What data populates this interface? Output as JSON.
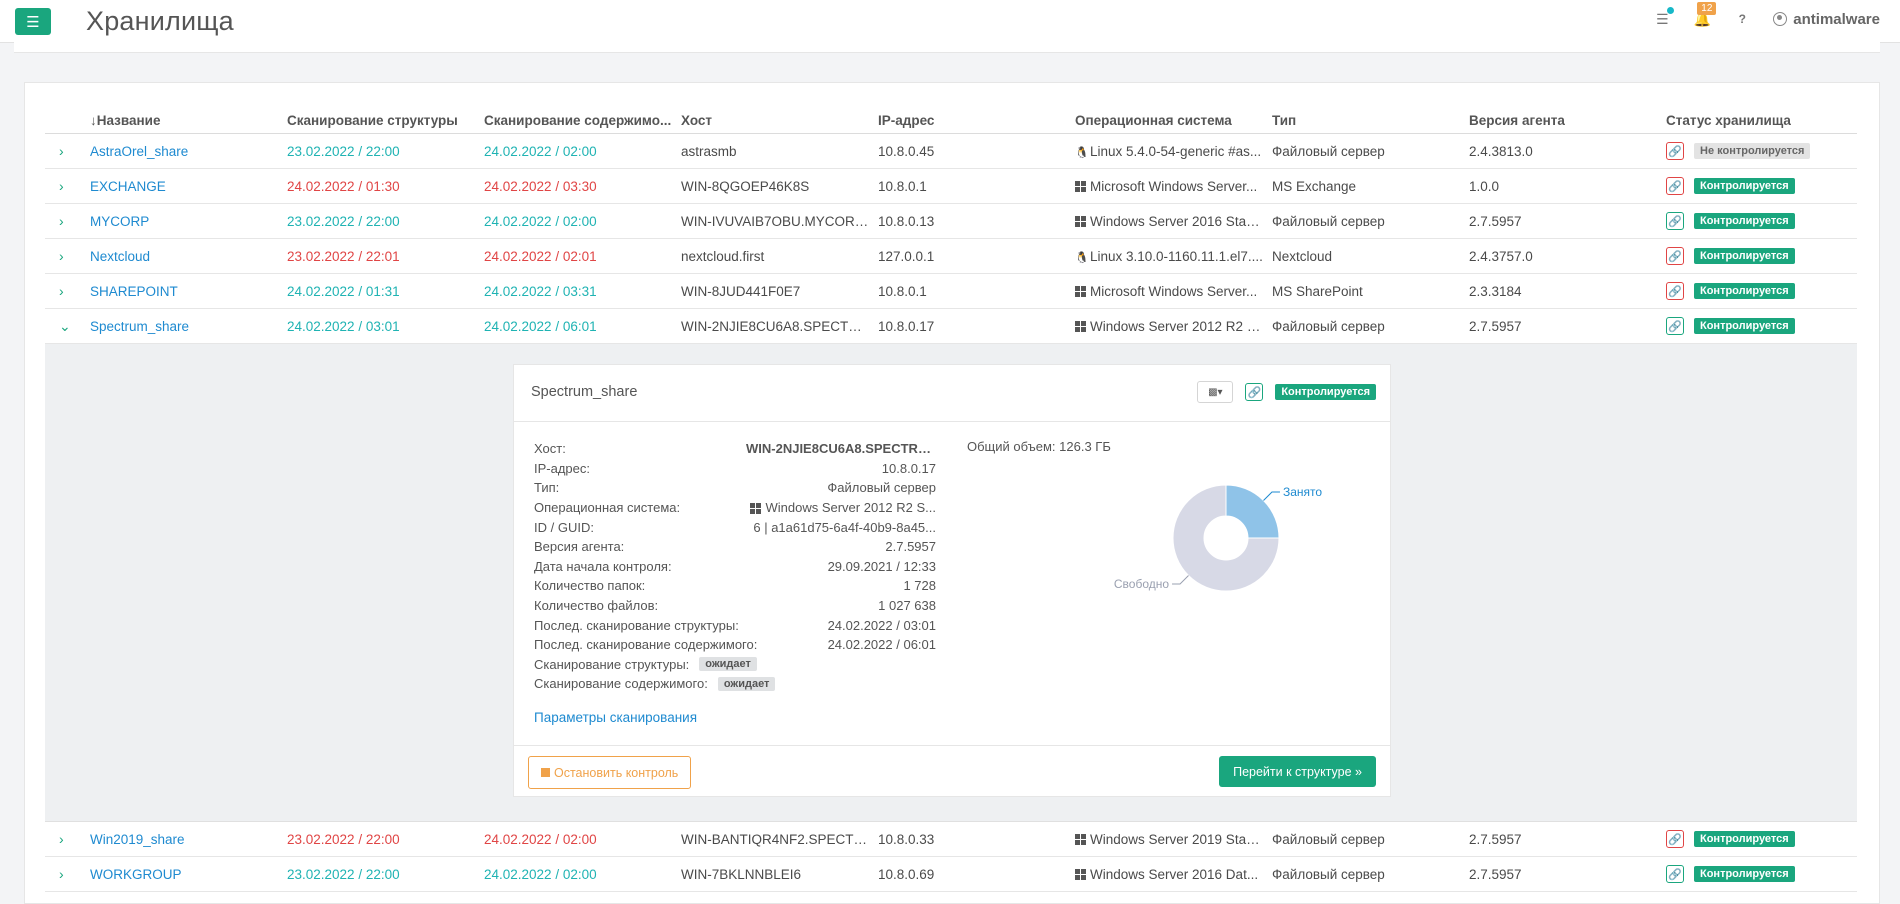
{
  "header": {
    "title": "Хранилища",
    "notifications_count": "12",
    "user": "antimalware"
  },
  "table": {
    "columns": [
      "Название",
      "Сканирование структуры",
      "Сканирование содержимо...",
      "Хост",
      "IP-адрес",
      "Операционная система",
      "Тип",
      "Версия агента",
      "Статус хранилища"
    ],
    "rows": [
      {
        "name": "AstraOrel_share",
        "struct": "23.02.2022 / 22:00",
        "struct_color": "teal",
        "content": "24.02.2022 / 02:00",
        "content_color": "teal",
        "host": "astrasmb",
        "ip": "10.8.0.45",
        "os_icon": "linux-icon",
        "os": "Linux 5.4.0-54-generic #as...",
        "type": "Файловый сервер",
        "agent": "2.4.3813.0",
        "link_color": "red",
        "status": "Не контролируется",
        "status_style": "grey"
      },
      {
        "name": "EXCHANGE",
        "struct": "24.02.2022 / 01:30",
        "struct_color": "red",
        "content": "24.02.2022 / 03:30",
        "content_color": "red",
        "host": "WIN-8QGOEP46K8S",
        "ip": "10.8.0.1",
        "os_icon": "windows-icon",
        "os": "Microsoft Windows Server...",
        "type": "MS Exchange",
        "agent": "1.0.0",
        "link_color": "red",
        "status": "Контролируется",
        "status_style": "green"
      },
      {
        "name": "MYCORP",
        "struct": "23.02.2022 / 22:00",
        "struct_color": "teal",
        "content": "24.02.2022 / 02:00",
        "content_color": "teal",
        "host": "WIN-IVUVAIB7OBU.MYCORP....",
        "ip": "10.8.0.13",
        "os_icon": "windows-icon",
        "os": "Windows Server 2016 Stan...",
        "type": "Файловый сервер",
        "agent": "2.7.5957",
        "link_color": "green",
        "status": "Контролируется",
        "status_style": "green"
      },
      {
        "name": "Nextcloud",
        "struct": "23.02.2022 / 22:01",
        "struct_color": "red",
        "content": "24.02.2022 / 02:01",
        "content_color": "red",
        "host": "nextcloud.first",
        "ip": "127.0.0.1",
        "os_icon": "linux-icon",
        "os": "Linux 3.10.0-1160.11.1.el7....",
        "type": "Nextcloud",
        "agent": "2.4.3757.0",
        "link_color": "red",
        "status": "Контролируется",
        "status_style": "green"
      },
      {
        "name": "SHAREPOINT",
        "struct": "24.02.2022 / 01:31",
        "struct_color": "teal",
        "content": "24.02.2022 / 03:31",
        "content_color": "teal",
        "host": "WIN-8JUD441F0E7",
        "ip": "10.8.0.1",
        "os_icon": "windows-icon",
        "os": "Microsoft Windows Server...",
        "type": "MS SharePoint",
        "agent": "2.3.3184",
        "link_color": "red",
        "status": "Контролируется",
        "status_style": "green"
      },
      {
        "name": "Spectrum_share",
        "struct": "24.02.2022 / 03:01",
        "struct_color": "teal",
        "content": "24.02.2022 / 06:01",
        "content_color": "teal",
        "host": "WIN-2NJIE8CU6A8.SPECTRU...",
        "ip": "10.8.0.17",
        "os_icon": "windows-icon",
        "os": "Windows Server 2012 R2 S...",
        "type": "Файловый сервер",
        "agent": "2.7.5957",
        "link_color": "green",
        "status": "Контролируется",
        "status_style": "green",
        "expanded": true
      },
      {
        "name": "Win2019_share",
        "struct": "23.02.2022 / 22:00",
        "struct_color": "red",
        "content": "24.02.2022 / 02:00",
        "content_color": "red",
        "host": "WIN-BANTIQR4NF2.SPECTRU...",
        "ip": "10.8.0.33",
        "os_icon": "windows-icon",
        "os": "Windows Server 2019 Stan...",
        "type": "Файловый сервер",
        "agent": "2.7.5957",
        "link_color": "red",
        "status": "Контролируется",
        "status_style": "green"
      },
      {
        "name": "WORKGROUP",
        "struct": "23.02.2022 / 22:00",
        "struct_color": "teal",
        "content": "24.02.2022 / 02:00",
        "content_color": "teal",
        "host": "WIN-7BKLNNBLEI6",
        "ip": "10.8.0.69",
        "os_icon": "windows-icon",
        "os": "Windows Server 2016 Dat...",
        "type": "Файловый сервер",
        "agent": "2.7.5957",
        "link_color": "green",
        "status": "Контролируется",
        "status_style": "green"
      }
    ]
  },
  "detail": {
    "title": "Spectrum_share",
    "status": "Контролируется",
    "fields": [
      {
        "k": "Хост:",
        "v": "WIN-2NJIE8CU6A8.SPECTRU...",
        "bold": true
      },
      {
        "k": "IP-адрес:",
        "v": "10.8.0.17"
      },
      {
        "k": "Тип:",
        "v": "Файловый сервер"
      },
      {
        "k": "Операционная система:",
        "v": "Windows Server 2012 R2 S...",
        "win": true
      },
      {
        "k": "ID / GUID:",
        "v": "6 | a1a61d75-6a4f-40b9-8a45..."
      },
      {
        "k": "Версия агента:",
        "v": "2.7.5957"
      },
      {
        "k": "Дата начала контроля:",
        "v": "29.09.2021 / 12:33"
      },
      {
        "k": "Количество папок:",
        "v": "1 728"
      },
      {
        "k": "Количество файлов:",
        "v": "1 027 638"
      },
      {
        "k": "Послед. сканирование структуры:",
        "v": "24.02.2022 / 03:01",
        "teal": true
      },
      {
        "k": "Послед. сканирование содержимого:",
        "v": "24.02.2022 / 06:01",
        "teal": true
      }
    ],
    "scan_status": [
      {
        "k": "Сканирование структуры:",
        "v": "ожидает"
      },
      {
        "k": "Сканирование содержимого:",
        "v": "ожидает"
      }
    ],
    "params_link": "Параметры сканирования",
    "total": "Общий объем: 126.3 ГБ",
    "stop_button": "Остановить контроль",
    "go_button": "Перейти к структуре »",
    "chart_data": {
      "type": "pie",
      "slices": [
        {
          "label": "Занято",
          "value": 25,
          "color": "#8fc3e8"
        },
        {
          "label": "Свободно",
          "value": 75,
          "color": "#d7d9e6"
        }
      ]
    }
  },
  "colors": {
    "accent": "#1aa67e",
    "link": "#1e8ad0",
    "teal": "#1fb3b3",
    "red": "#e04545",
    "warn": "#f0a24a"
  }
}
